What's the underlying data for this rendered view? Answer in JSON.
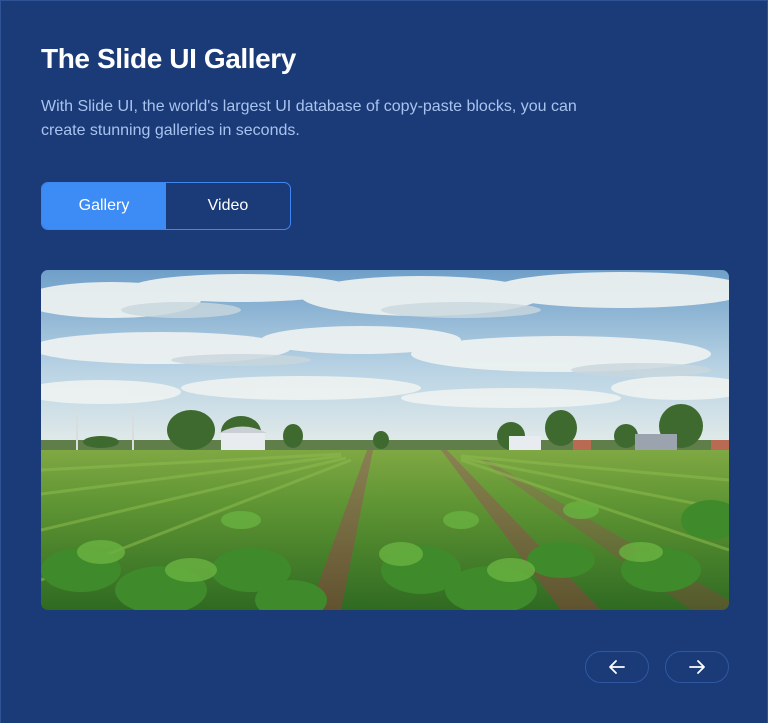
{
  "header": {
    "title": "The Slide UI Gallery",
    "description": "With Slide UI, the world's largest UI database of copy-paste blocks, you can create stunning galleries in seconds."
  },
  "tabs": [
    {
      "label": "Gallery",
      "active": true
    },
    {
      "label": "Video",
      "active": false
    }
  ],
  "gallery": {
    "image": "farmland-field-illustration"
  },
  "navigation": {
    "prev_icon": "arrow-left-icon",
    "next_icon": "arrow-right-icon"
  },
  "colors": {
    "background": "#1b3b78",
    "accent": "#3d8cf5",
    "description_text": "#a9c3ef"
  }
}
